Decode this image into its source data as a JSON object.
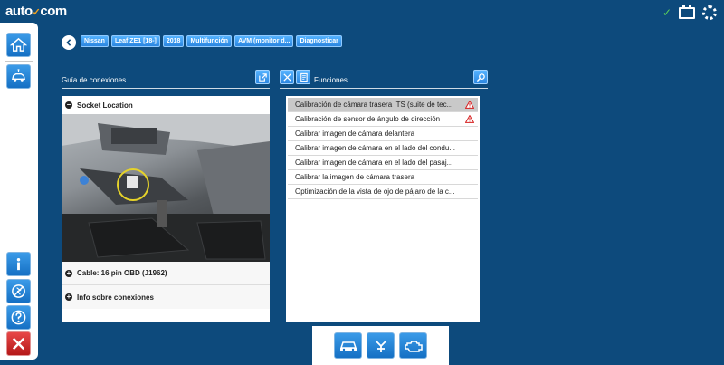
{
  "app": {
    "logo_main": "auto",
    "logo_suffix": "com"
  },
  "breadcrumbs": [
    "Nissan",
    "Leaf ZE1 [18-]",
    "2018",
    "Multifunción",
    "AVM (monitor d...",
    "Diagnosticar"
  ],
  "left_panel": {
    "title": "Guía de conexiones",
    "socket_location_label": "Socket Location",
    "cable_label": "Cable: 16 pin OBD (J1962)",
    "info_label": "Info sobre conexiones"
  },
  "right_panel": {
    "title": "Funciones",
    "items": [
      {
        "label": "Calibración de cámara trasera ITS (suite de tec...",
        "warning": true,
        "selected": true
      },
      {
        "label": "Calibración de sensor de ángulo de dirección",
        "warning": true,
        "selected": false
      },
      {
        "label": "Calibrar imagen de cámara delantera",
        "warning": false,
        "selected": false
      },
      {
        "label": "Calibrar imagen de cámara en el lado del condu...",
        "warning": false,
        "selected": false
      },
      {
        "label": "Calibrar imagen de cámara en el lado del pasaj...",
        "warning": false,
        "selected": false
      },
      {
        "label": "Calibrar la imagen de cámara trasera",
        "warning": false,
        "selected": false
      },
      {
        "label": "Optimización de la vista de ojo de pájaro de la c...",
        "warning": false,
        "selected": false
      }
    ]
  },
  "colors": {
    "background": "#0d4a7c",
    "accent": "#2b86e0",
    "warning": "#d62020",
    "selected": "#c9c9c9"
  },
  "icons": {
    "sidebar": [
      "home-icon",
      "car-connect-icon",
      "info-icon",
      "no-flash-icon",
      "help-icon",
      "close-icon"
    ],
    "bottom": [
      "car-front-icon",
      "tools-icon",
      "engine-icon"
    ]
  }
}
